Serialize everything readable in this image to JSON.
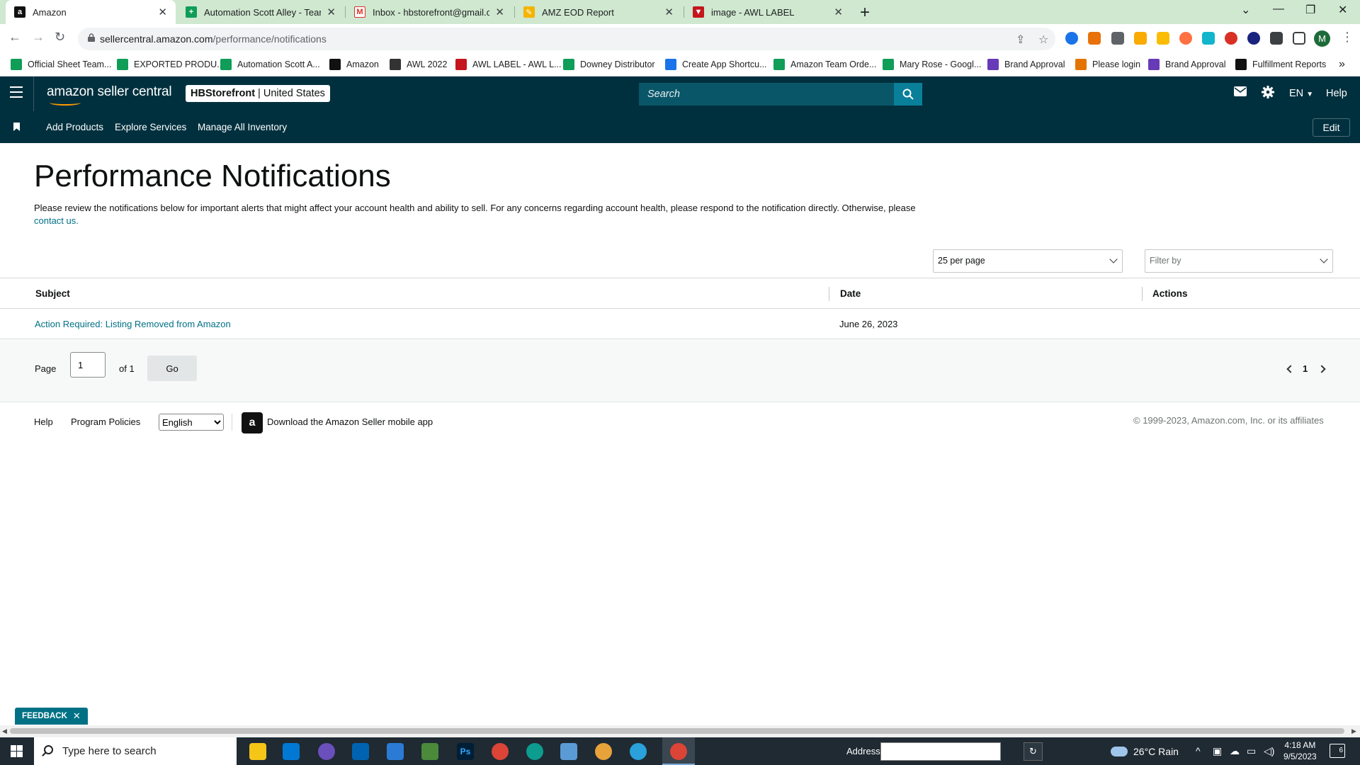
{
  "browser": {
    "tabs": [
      {
        "title": "Amazon",
        "icon": "amazon-favicon",
        "active": true
      },
      {
        "title": "Automation Scott Alley - Team O",
        "icon": "sheets-favicon",
        "active": false
      },
      {
        "title": "Inbox - hbstorefront@gmail.com",
        "icon": "gmail-favicon",
        "active": false
      },
      {
        "title": "AMZ EOD Report",
        "icon": "pencil-favicon",
        "active": false
      },
      {
        "title": "image - AWL LABEL",
        "icon": "awl-favicon",
        "active": false
      }
    ],
    "url_host": "sellercentral.amazon.com",
    "url_path": "/performance/notifications",
    "profile_initial": "M",
    "bookmarks": [
      {
        "label": "Official Sheet Team...",
        "icon": "sheets-icon",
        "color": "#0f9d58"
      },
      {
        "label": "EXPORTED PRODU...",
        "icon": "sheets-icon",
        "color": "#0f9d58"
      },
      {
        "label": "Automation Scott A...",
        "icon": "sheets-icon",
        "color": "#0f9d58"
      },
      {
        "label": "Amazon",
        "icon": "amazon-icon",
        "color": "#111111"
      },
      {
        "label": "AWL 2022",
        "icon": "globe-icon",
        "color": "#333333"
      },
      {
        "label": "AWL LABEL - AWL L...",
        "icon": "awl-icon",
        "color": "#c4161c"
      },
      {
        "label": "Downey Distributor",
        "icon": "sheets-icon",
        "color": "#0f9d58"
      },
      {
        "label": "Create App Shortcu...",
        "icon": "arrow-icon",
        "color": "#1a73e8"
      },
      {
        "label": "Amazon Team Orde...",
        "icon": "sheets-icon",
        "color": "#0f9d58"
      },
      {
        "label": "Mary Rose - Googl...",
        "icon": "sheets-icon",
        "color": "#0f9d58"
      },
      {
        "label": "Brand Approval",
        "icon": "forms-icon",
        "color": "#673ab7"
      },
      {
        "label": "Please login",
        "icon": "signature-icon",
        "color": "#e37400"
      },
      {
        "label": "Brand Approval",
        "icon": "forms-icon",
        "color": "#673ab7"
      },
      {
        "label": "Fulfillment Reports",
        "icon": "amazon-icon",
        "color": "#111111"
      }
    ]
  },
  "header": {
    "logo_text": "amazon seller central",
    "store_name": "HBStorefront",
    "store_region": "United States",
    "search_placeholder": "Search",
    "language": "EN",
    "help_label": "Help"
  },
  "nav": {
    "items": [
      "Add Products",
      "Explore Services",
      "Manage All Inventory"
    ],
    "edit_label": "Edit"
  },
  "page": {
    "title": "Performance Notifications",
    "intro": "Please review the notifications below for important alerts that might affect your account health and ability to sell. For any concerns regarding account health, please respond to the notification directly. Otherwise, please",
    "contact_link": "contact us.",
    "per_page": "25 per page",
    "filter_placeholder": "Filter by"
  },
  "table": {
    "columns": [
      "Subject",
      "Date",
      "Actions"
    ],
    "rows": [
      {
        "subject": "Action Required: Listing Removed from Amazon",
        "date": "June 26, 2023",
        "actions": ""
      }
    ]
  },
  "pager": {
    "page_label": "Page",
    "current": "1",
    "of_label": "of 1",
    "go_label": "Go",
    "page_number": "1"
  },
  "footer": {
    "help": "Help",
    "program_policies": "Program Policies",
    "language": "English",
    "app_download": "Download the Amazon Seller mobile app",
    "copyright": "© 1999-2023, Amazon.com, Inc. or its affiliates"
  },
  "feedback_label": "FEEDBACK",
  "taskbar": {
    "search_placeholder": "Type here to search",
    "address_label": "Address",
    "weather": "26°C  Rain",
    "time": "4:18 AM",
    "date": "9/5/2023",
    "notification_count": "6"
  }
}
